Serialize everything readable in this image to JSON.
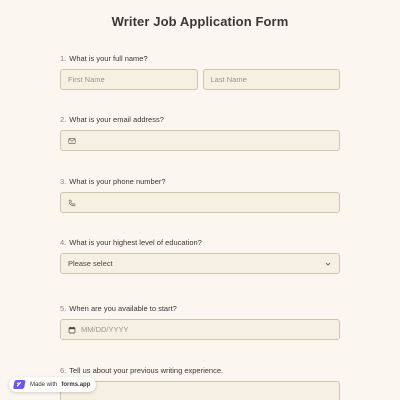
{
  "form": {
    "title": "Writer Job Application Form"
  },
  "questions": [
    {
      "number": "1.",
      "label": "What is your full name?",
      "first_placeholder": "First Name",
      "last_placeholder": "Last Name"
    },
    {
      "number": "2.",
      "label": "What is your email address?",
      "icon": "envelope-icon"
    },
    {
      "number": "3.",
      "label": "What is your phone number?",
      "icon": "phone-icon"
    },
    {
      "number": "4.",
      "label": "What is your highest level of education?",
      "selected": "Please select",
      "icon": "chevron-down-icon"
    },
    {
      "number": "5.",
      "label": "When are you available to start?",
      "placeholder": "MM/DD/YYYY",
      "icon": "calendar-icon"
    },
    {
      "number": "6.",
      "label": "Tell us about your previous writing experience."
    }
  ],
  "badge": {
    "made_with": "Made with",
    "brand": "forms.app",
    "icon": "forms-app-logo-icon"
  },
  "colors": {
    "background": "#fbf7f0",
    "field_background": "#f6f0e2",
    "field_border": "#cfc4ad",
    "badge_logo": "#6b5ce7"
  }
}
